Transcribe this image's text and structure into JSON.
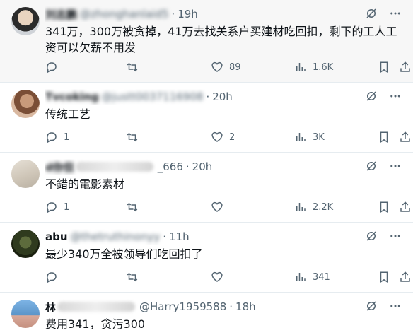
{
  "tweets": [
    {
      "name": "刘志鹏",
      "handle": "@zhonghanlaid5",
      "time": "19h",
      "text": "341万，300万被贪掉，41万去找关系户买建材吃回扣，剩下的工人工资可以欠薪不用发",
      "replies": "",
      "retweets": "",
      "likes": "89",
      "views": "1.6K"
    },
    {
      "name": "Tvcoking",
      "handle": "@justt0037116908",
      "time": "20h",
      "text": "传统工艺",
      "replies": "1",
      "retweets": "",
      "likes": "2",
      "views": "3K"
    },
    {
      "name": "d你但",
      "handle": "_666",
      "time": "20h",
      "text": "不錯的電影素材",
      "replies": "1",
      "retweets": "",
      "likes": "",
      "views": "2.2K"
    },
    {
      "name": "abu",
      "handle": "@thetruthinonyy",
      "time": "11h",
      "text": "最少340万全被领导们吃回扣了",
      "replies": "",
      "retweets": "",
      "likes": "",
      "views": "341"
    },
    {
      "name": "林",
      "handle": "@Harry1959588",
      "time": "18h",
      "text": "费用341，贪污300"
    }
  ],
  "icons": {
    "reply": "reply-icon",
    "retweet": "retweet-icon",
    "like": "like-icon",
    "views": "views-icon",
    "bookmark": "bookmark-icon",
    "share": "share-icon",
    "grok": "grok-icon",
    "more": "more-icon"
  }
}
